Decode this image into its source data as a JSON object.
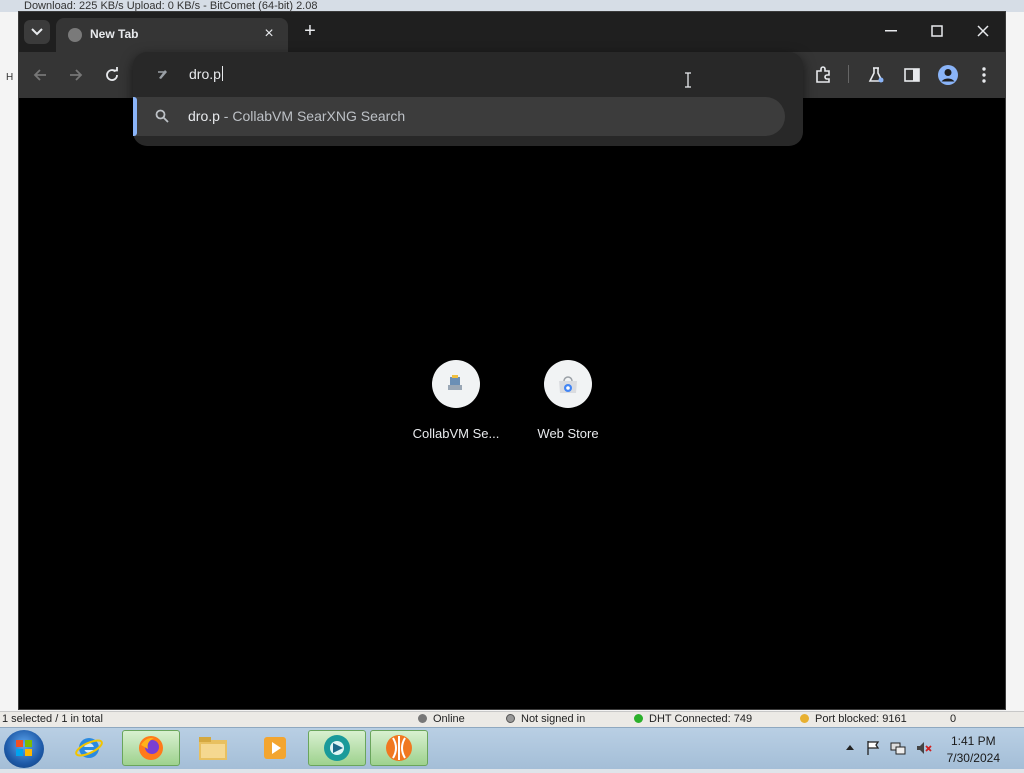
{
  "background_window": {
    "title": "Download: 225 KB/s  Upload: 0 KB/s - BitComet (64-bit) 2.08",
    "status": {
      "selection": "1 selected / 1 in total",
      "online": "Online",
      "signin": "Not signed in",
      "dht": "DHT Connected: 749",
      "port": "Port blocked: 9161",
      "extra": "0"
    }
  },
  "tab": {
    "title": "New Tab",
    "close_label": "×",
    "new_tab_label": "+"
  },
  "omnibox": {
    "input_value": "dro.p",
    "suggestion": {
      "query": "dro.p",
      "description": " - CollabVM SearXNG Search"
    }
  },
  "shortcuts": [
    {
      "label": "CollabVM Se...",
      "icon": "collabvm-icon"
    },
    {
      "label": "Web Store",
      "icon": "web-store-icon"
    }
  ],
  "tray": {
    "time": "1:41 PM",
    "date": "7/30/2024"
  },
  "colors": {
    "accent": "#8ab4f8",
    "tabstrip": "#1f1f1f",
    "toolbar": "#353535",
    "page_bg": "#000000"
  }
}
